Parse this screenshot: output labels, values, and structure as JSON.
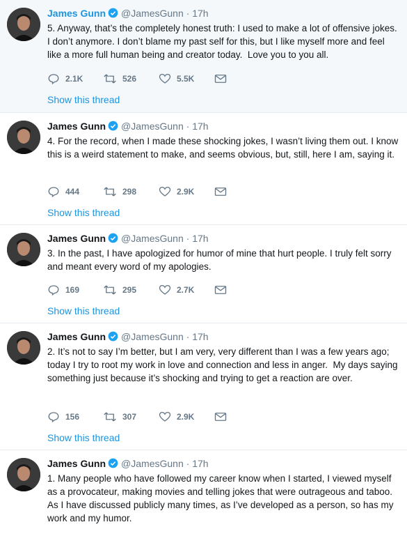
{
  "tweets": [
    {
      "name": "James Gunn",
      "handle": "@JamesGunn",
      "separator": "·",
      "time": "17h",
      "text": "5. Anyway, that’s the completely honest truth: I used to make a lot of offensive jokes. I don’t anymore. I don’t blame my past self for this, but I like myself more and feel like a more full human being and creator today.  Love you to you all.",
      "replies": "2.1K",
      "retweets": "526",
      "likes": "5.5K",
      "show_thread": "Show this thread"
    },
    {
      "name": "James Gunn",
      "handle": "@JamesGunn",
      "separator": "·",
      "time": "17h",
      "text": "4. For the record, when I made these shocking jokes, I wasn’t living them out. I know this is a weird statement to make, and seems obvious, but, still, here I am, saying it.",
      "replies": "444",
      "retweets": "298",
      "likes": "2.9K",
      "show_thread": "Show this thread"
    },
    {
      "name": "James Gunn",
      "handle": "@JamesGunn",
      "separator": "·",
      "time": "17h",
      "text": "3. In the past, I have apologized for humor of mine that hurt people. I truly felt sorry and meant every word of my apologies.",
      "replies": "169",
      "retweets": "295",
      "likes": "2.7K",
      "show_thread": "Show this thread"
    },
    {
      "name": "James Gunn",
      "handle": "@JamesGunn",
      "separator": "·",
      "time": "17h",
      "text": "2. It’s not to say I’m better, but I am very, very different than I was a few years ago; today I try to root my work in love and connection and less in anger.  My days saying something just because it’s shocking and trying to get a reaction are over.",
      "replies": "156",
      "retweets": "307",
      "likes": "2.9K",
      "show_thread": "Show this thread"
    },
    {
      "name": "James Gunn",
      "handle": "@JamesGunn",
      "separator": "·",
      "time": "17h",
      "text": "1. Many people who have followed my career know when I started, I viewed myself as a provocateur, making movies and telling jokes that were outrageous and taboo. As I have discussed publicly many times, as I’ve developed as a person, so has my work and my humor."
    }
  ],
  "colors": {
    "link": "#1b95e0",
    "muted": "#657786",
    "text": "#14171a",
    "highlight_bg": "#f5f8fa",
    "divider": "#e6ecf0"
  },
  "icons": [
    "reply-icon",
    "retweet-icon",
    "like-icon",
    "direct-message-icon",
    "verified-badge-icon"
  ]
}
